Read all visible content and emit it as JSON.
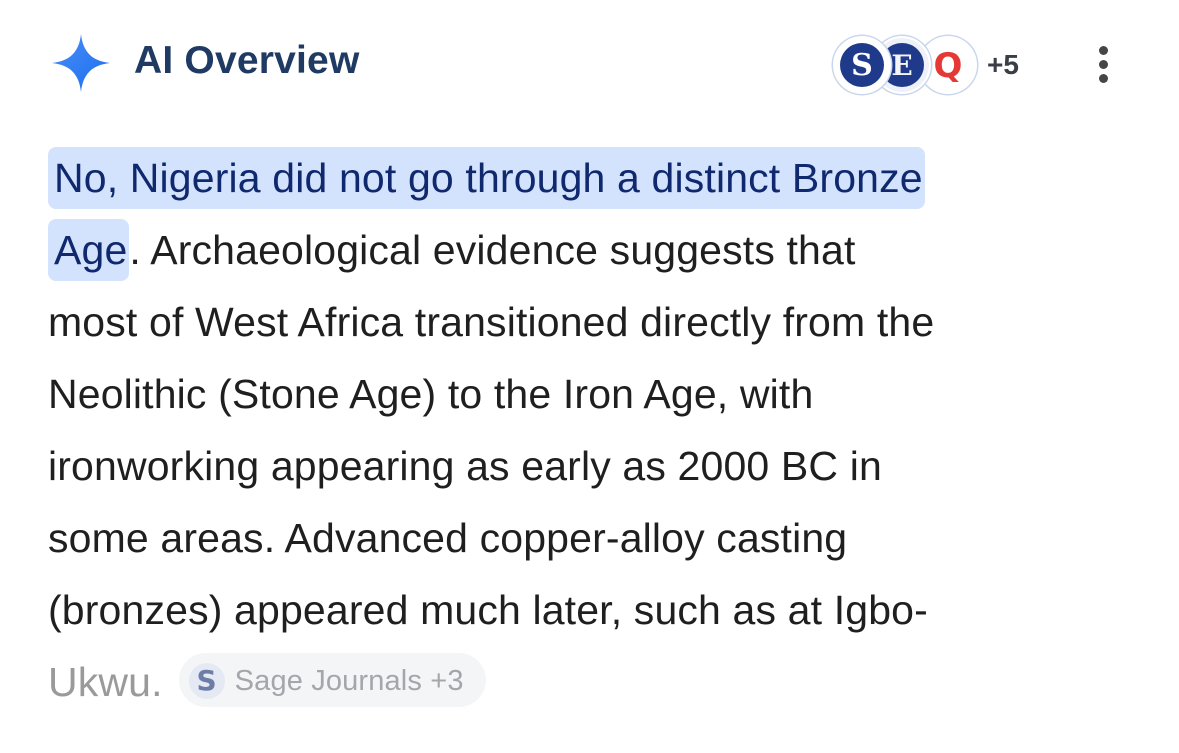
{
  "header": {
    "title": "AI Overview",
    "icon": "sparkle-icon",
    "accent_color": "#1a73e8",
    "sources": [
      {
        "letter": "S",
        "icon": "source-s-logo",
        "color": "#1f3a8a"
      },
      {
        "letter": "E",
        "icon": "source-e-logo",
        "color": "#1f3a8a"
      },
      {
        "letter": "Q",
        "icon": "source-q-logo",
        "color": "#e53935"
      }
    ],
    "more_sources": "+5",
    "menu_icon": "more-vert-icon"
  },
  "answer": {
    "highlight_line1": "No, Nigeria did not go through a distinct Bronze",
    "highlight_line2": "Age",
    "line2_rest": ". Archaeological evidence suggests that",
    "line3": "most of West Africa transitioned directly from the",
    "line4": "Neolithic (Stone Age) to the Iron Age, with",
    "line5": "ironworking appearing as early as 2000 BC in",
    "line6": "some areas. Advanced copper-alloy casting",
    "line7": "(bronzes) appeared much later, such as at Igbo-",
    "line8": "Ukwu.",
    "highlight_color": "#d3e3fd"
  },
  "citation": {
    "icon_letter": "S",
    "icon": "sage-journals-icon",
    "label": "Sage Journals +3"
  }
}
